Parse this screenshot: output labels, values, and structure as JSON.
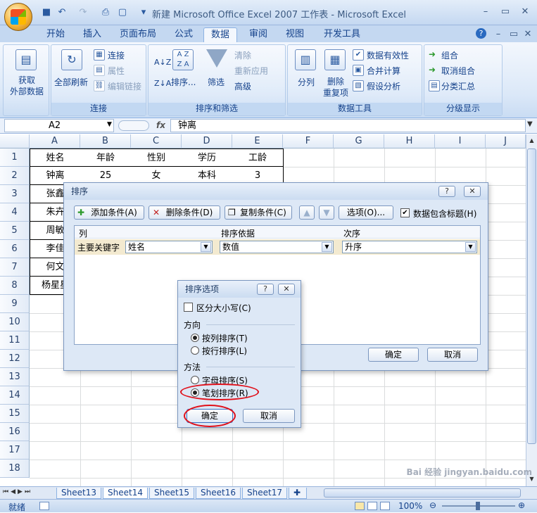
{
  "window": {
    "title": "新建 Microsoft Office Excel 2007 工作表 - Microsoft Excel"
  },
  "tabs": [
    "开始",
    "插入",
    "页面布局",
    "公式",
    "数据",
    "审阅",
    "视图",
    "开发工具"
  ],
  "active_tab": "数据",
  "ribbon": {
    "get_external": "获取\n外部数据",
    "connections": {
      "refresh_all": "全部刷新",
      "connect": "连接",
      "properties": "属性",
      "edit_links": "编辑链接",
      "caption": "连接"
    },
    "sortfilter": {
      "sort": "排序...",
      "filter": "筛选",
      "clear": "清除",
      "reapply": "重新应用",
      "advanced": "高级",
      "caption": "排序和筛选"
    },
    "datatools": {
      "text_to_cols": "分列",
      "remove_dup": "删除\n重复项",
      "validation": "数据有效性",
      "consolidate": "合并计算",
      "whatif": "假设分析",
      "caption": "数据工具"
    },
    "outline": {
      "group": "组合",
      "ungroup": "取消组合",
      "subtotal": "分类汇总",
      "caption": "分级显示"
    }
  },
  "formula_bar": {
    "name_box": "A2",
    "fx": "fx",
    "content": "钟离"
  },
  "columns": [
    "A",
    "B",
    "C",
    "D",
    "E",
    "F",
    "G",
    "H",
    "I",
    "J"
  ],
  "rows": [
    "1",
    "2",
    "3",
    "4",
    "5",
    "6",
    "7",
    "8",
    "9",
    "10",
    "11",
    "12",
    "13",
    "14",
    "15",
    "16",
    "17",
    "18"
  ],
  "cells": {
    "header": [
      "姓名",
      "年龄",
      "性别",
      "学历",
      "工龄"
    ],
    "row2": [
      "钟离",
      "25",
      "女",
      "本科",
      "3"
    ],
    "col_a": [
      "张鑫",
      "朱卉",
      "周敏",
      "李佳",
      "何文",
      "杨星星"
    ]
  },
  "sheets": [
    "Sheet13",
    "Sheet14",
    "Sheet15",
    "Sheet16",
    "Sheet17"
  ],
  "active_sheet": "Sheet14",
  "status": {
    "ready": "就绪",
    "zoom": "100%"
  },
  "sort_dialog": {
    "title": "排序",
    "add_level": "添加条件(A)",
    "delete_level": "删除条件(D)",
    "copy_level": "复制条件(C)",
    "options": "选项(O)...",
    "has_headers": "数据包含标题(H)",
    "col_header": "列",
    "sorton_header": "排序依据",
    "order_header": "次序",
    "row_label": "主要关键字",
    "column_value": "姓名",
    "sorton_value": "数值",
    "order_value": "升序",
    "ok": "确定",
    "cancel": "取消"
  },
  "options_dialog": {
    "title": "排序选项",
    "case_sensitive": "区分大小写(C)",
    "direction_label": "方向",
    "top_to_bottom": "按列排序(T)",
    "left_to_right": "按行排序(L)",
    "method_label": "方法",
    "letter_sort": "字母排序(S)",
    "stroke_sort": "笔划排序(R)",
    "ok": "确定",
    "cancel": "取消"
  },
  "watermark": "Bai 经验 jingyan.baidu.com"
}
